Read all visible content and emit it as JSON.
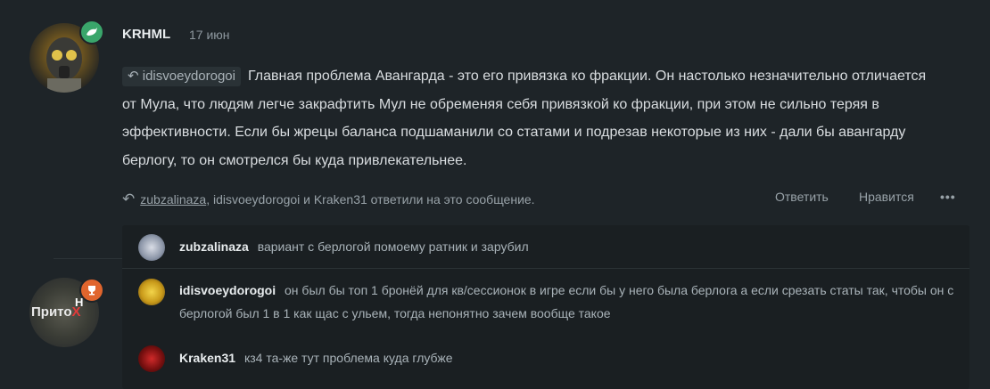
{
  "post": {
    "author": "KRHML",
    "date": "17 июн",
    "quote_author": "idisvoeydorogoi",
    "text": "Главная проблема Авангарда - это его привязка ко фракции. Он настолько незначительно отличается от Мула, что людям легче закрафтить Мул не обременяя себя привязкой ко фракции, при этом не сильно теряя в эффективности. Если бы жрецы баланса подшаманили со статами и подрезав некоторые из них - дали бы авангарду берлогу, то он смотрелся бы куда привлекательнее.",
    "replied_first": "zubzalinaza",
    "replied_rest": ", idisvoeydorogoi и Kraken31 ответили на это сообщение.",
    "reply_label": "Ответить",
    "like_label": "Нравится",
    "more_label": "•••"
  },
  "other_avatar_text": "Прито",
  "replies": [
    {
      "name": "zubzalinaza",
      "text": "вариант с берлогой помоему ратник и зарубил"
    },
    {
      "name": "idisvoeydorogoi",
      "text": "он был бы топ 1 бронёй для кв/сессионок в игре если бы у него была берлога а если срезать статы так, чтобы он с берлогой был 1 в 1 как щас с ульем, тогда непонятно зачем вообще такое"
    },
    {
      "name": "Kraken31",
      "text": "кз4 та-же тут проблема куда глубже"
    }
  ],
  "colors": {
    "background": "#1e2428",
    "badge_green": "#3aa66b",
    "badge_orange": "#e0652d"
  }
}
